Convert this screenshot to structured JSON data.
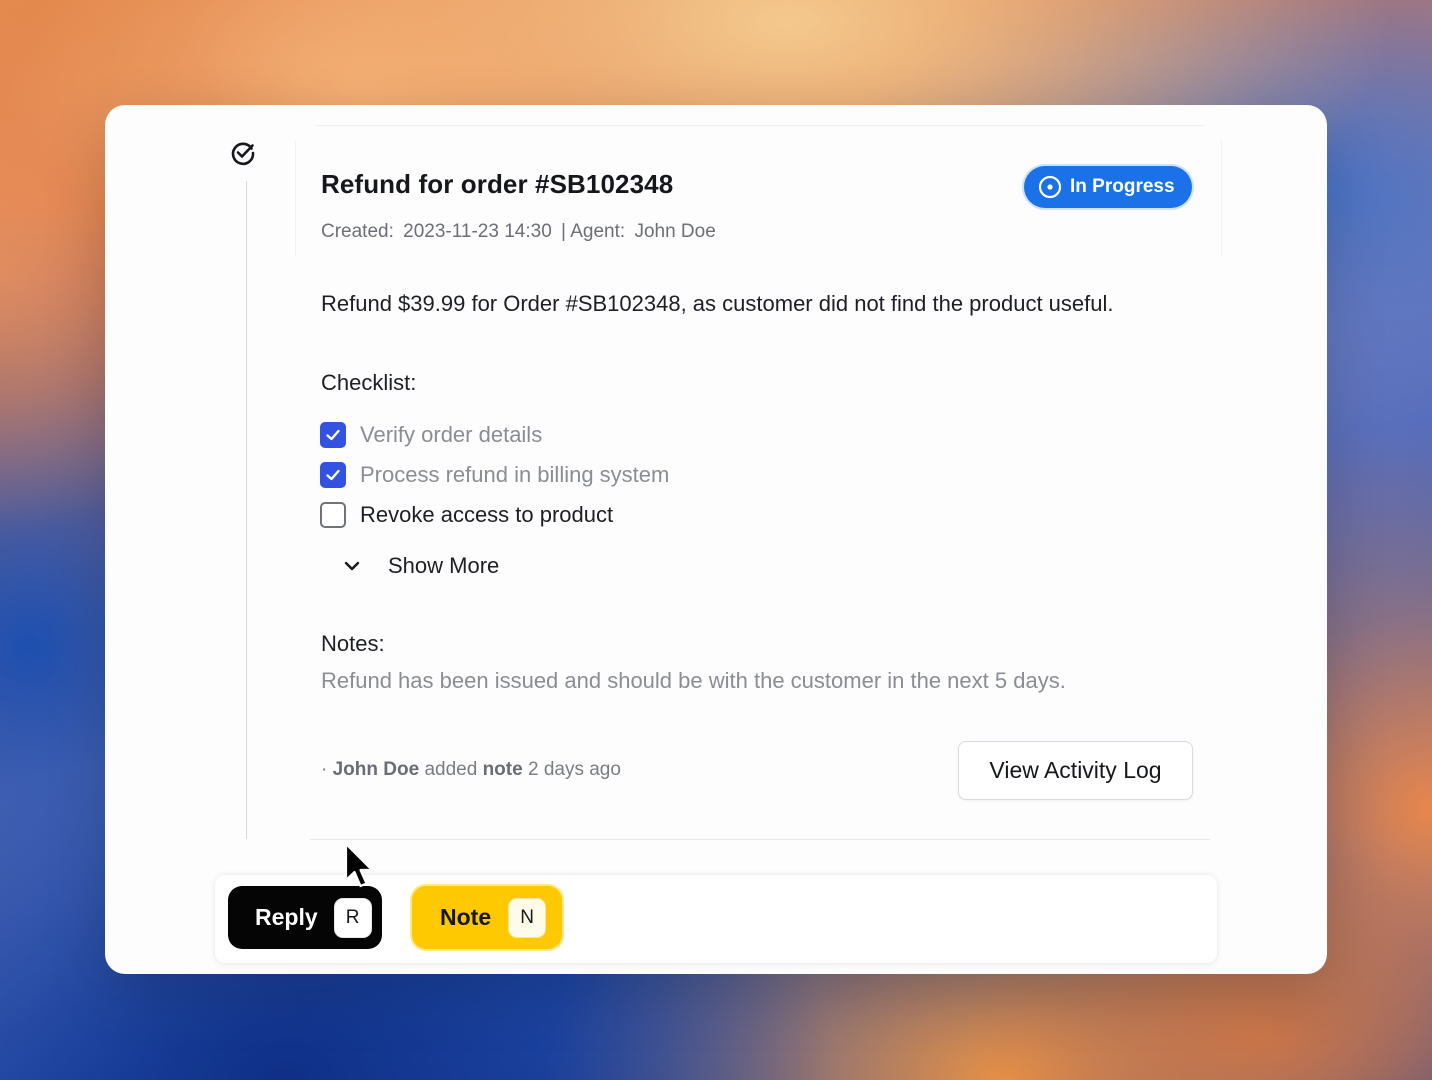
{
  "ticket": {
    "title": "Refund for order #SB102348",
    "created_label": "Created:",
    "created_value": "2023-11-23 14:30",
    "separator": "|",
    "agent_label": "Agent:",
    "agent_value": "John Doe",
    "status": {
      "label": "In Progress",
      "color": "#1b72e8",
      "icon": "in-progress-icon"
    },
    "description": "Refund $39.99 for Order #SB102348, as customer did not find the product useful.",
    "checklist_label": "Checklist:",
    "checklist": [
      {
        "label": "Verify order details",
        "checked": true
      },
      {
        "label": "Process refund in billing system",
        "checked": true
      },
      {
        "label": "Revoke access to product",
        "checked": false
      }
    ],
    "show_more_label": "Show More",
    "notes_label": "Notes:",
    "notes_text": "Refund has been issued and should be with the customer in the next 5 days.",
    "activity": {
      "prefix": "·",
      "actor": "John Doe",
      "verb": "added",
      "object": "note",
      "time": "2 days ago"
    },
    "view_log_label": "View Activity Log"
  },
  "actions": {
    "reply_label": "Reply",
    "reply_shortcut": "R",
    "note_label": "Note",
    "note_shortcut": "N"
  },
  "colors": {
    "accent_blue": "#1b72e8",
    "checkbox_blue": "#3452e1",
    "note_yellow": "#ffc902",
    "reply_black": "#050505"
  }
}
